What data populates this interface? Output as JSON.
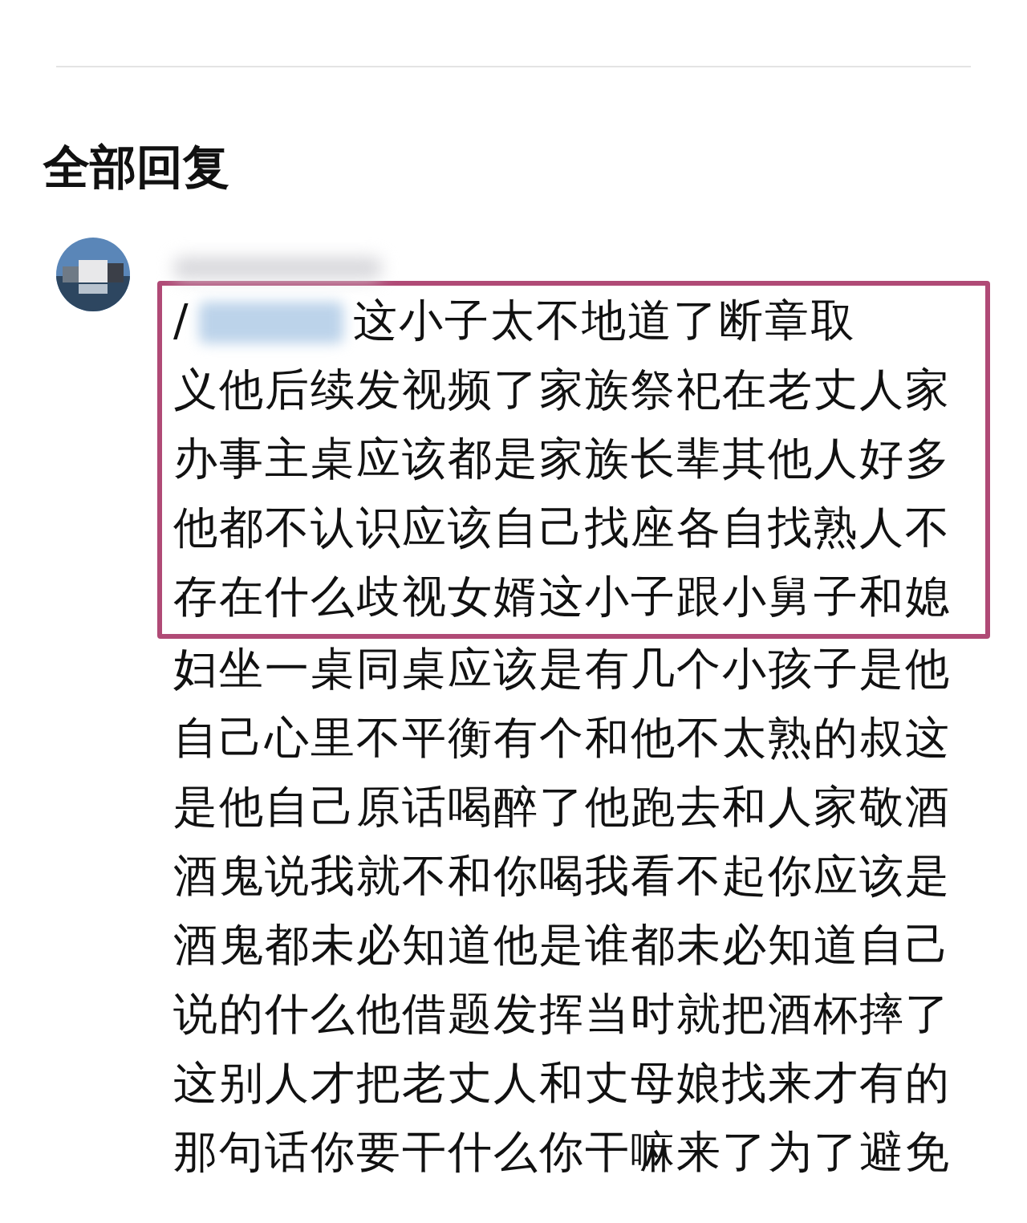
{
  "section_title": "全部回复",
  "reply": {
    "prefix": "/",
    "lines": [
      {
        "text": "这小子太不地道了断章取",
        "highlighted": true
      },
      {
        "text": "义他后续发视频了家族祭祀在老丈人家",
        "highlighted": true
      },
      {
        "text": "办事主桌应该都是家族长辈其他人好多",
        "highlighted": true
      },
      {
        "text": "他都不认识应该自己找座各自找熟人不",
        "highlighted": true
      },
      {
        "text": "存在什么歧视女婿这小子跟小舅子和媳",
        "highlighted": true
      },
      {
        "text": "妇坐一桌同桌应该是有几个小孩子是他",
        "highlighted": false
      },
      {
        "text": "自己心里不平衡有个和他不太熟的叔这",
        "highlighted": false
      },
      {
        "text": "是他自己原话喝醉了他跑去和人家敬酒",
        "highlighted": false
      },
      {
        "text": "酒鬼说我就不和你喝我看不起你应该是",
        "highlighted": false
      },
      {
        "text": "酒鬼都未必知道他是谁都未必知道自己",
        "highlighted": false
      },
      {
        "text": "说的什么他借题发挥当时就把酒杯摔了",
        "highlighted": false
      },
      {
        "text": "这别人才把老丈人和丈母娘找来才有的",
        "highlighted": false
      },
      {
        "text": "那句话你要干什么你干嘛来了为了避免",
        "highlighted": false
      }
    ]
  }
}
